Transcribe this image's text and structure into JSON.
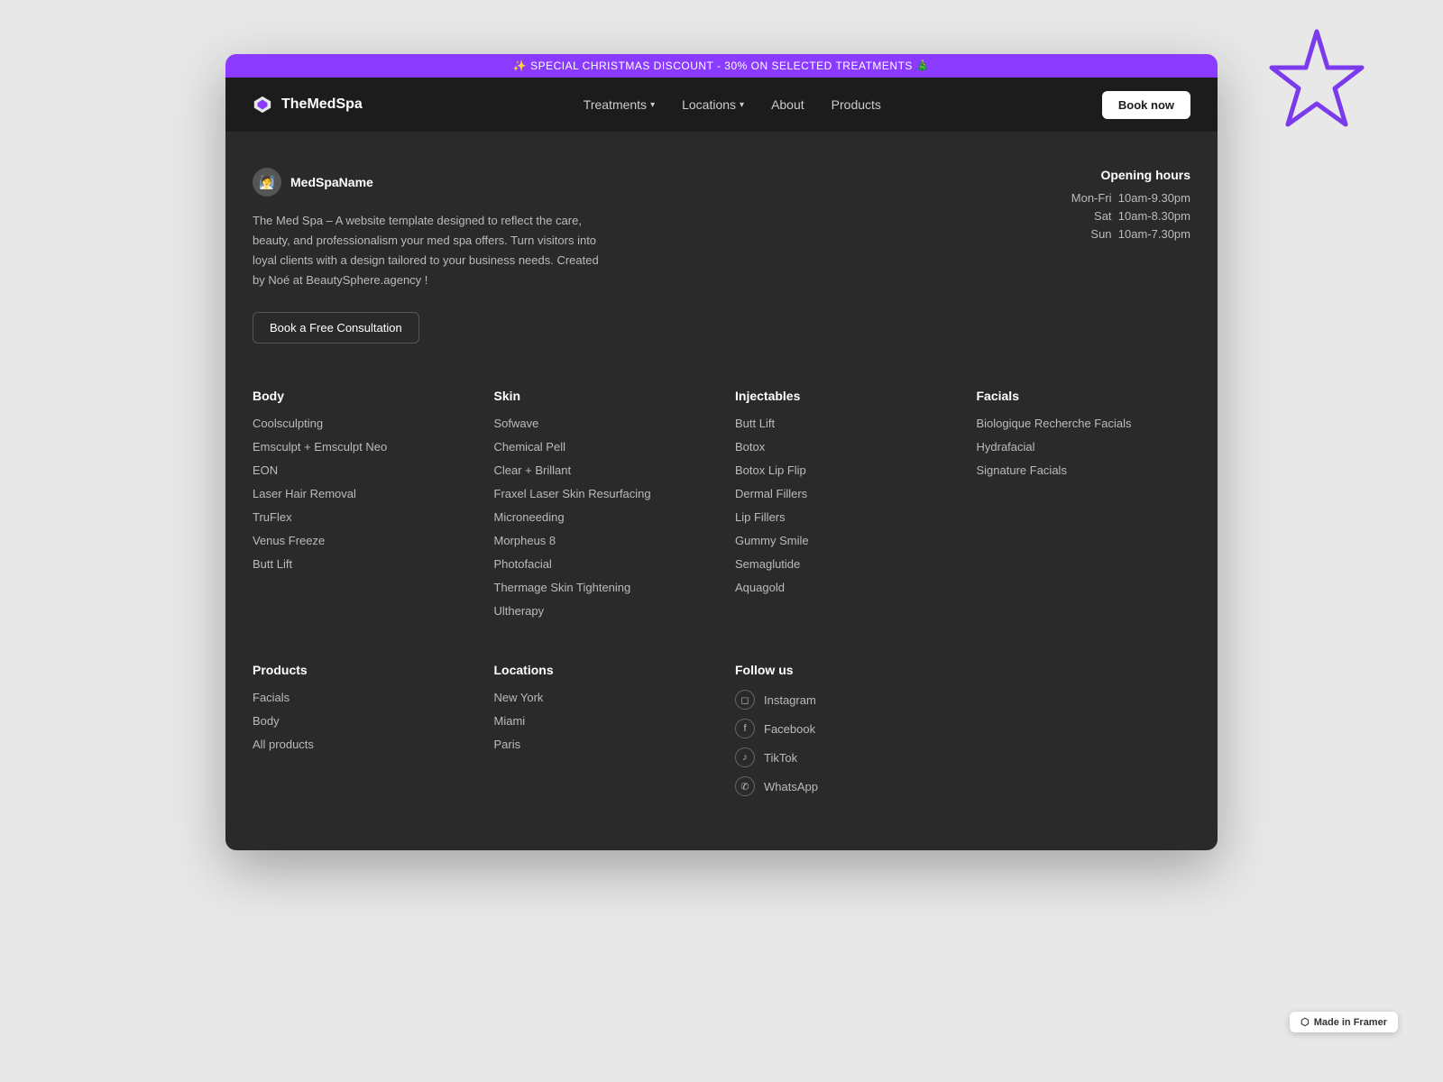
{
  "banner": {
    "text": "✨ SPECIAL CHRISTMAS DISCOUNT - 30% ON SELECTED TREATMENTS 🎄"
  },
  "navbar": {
    "logo_text": "TheMedSpa",
    "nav_items": [
      {
        "label": "Treatments",
        "has_dropdown": true
      },
      {
        "label": "Locations",
        "has_dropdown": true
      },
      {
        "label": "About",
        "has_dropdown": false
      },
      {
        "label": "Products",
        "has_dropdown": false
      }
    ],
    "book_btn": "Book now"
  },
  "hero": {
    "brand_name": "MedSpaName",
    "description": "The Med Spa – A website template designed to reflect the care, beauty, and professionalism your med spa offers. Turn visitors into loyal clients with a design tailored to your business needs. Created by Noé at BeautySphere.agency !",
    "consult_btn": "Book a Free Consultation",
    "opening_hours": {
      "title": "Opening hours",
      "rows": [
        {
          "day": "Mon-Fri",
          "hours": "10am-9.30pm"
        },
        {
          "day": "Sat",
          "hours": "10am-8.30pm"
        },
        {
          "day": "Sun",
          "hours": "10am-7.30pm"
        }
      ]
    }
  },
  "footer": {
    "body_col": {
      "title": "Body",
      "items": [
        "Coolsculpting",
        "Emsculpt + Emsculpt Neo",
        "EON",
        "Laser Hair Removal",
        "TruFlex",
        "Venus Freeze",
        "Butt Lift"
      ]
    },
    "skin_col": {
      "title": "Skin",
      "items": [
        "Sofwave",
        "Chemical Pell",
        "Clear + Brillant",
        "Fraxel Laser Skin Resurfacing",
        "Microneeding",
        "Morpheus 8",
        "Photofacial",
        "Thermage Skin Tightening",
        "Ultherapy"
      ]
    },
    "injectables_col": {
      "title": "Injectables",
      "items": [
        "Butt Lift",
        "Botox",
        "Botox Lip Flip",
        "Dermal Fillers",
        "Lip Fillers",
        "Gummy Smile",
        "Semaglutide",
        "Aquagold"
      ]
    },
    "facials_col": {
      "title": "Facials",
      "items": [
        "Biologique Recherche Facials",
        "Hydrafacial",
        "Signature Facials"
      ]
    },
    "products_col": {
      "title": "Products",
      "items": [
        "Facials",
        "Body",
        "All products"
      ]
    },
    "locations_col": {
      "title": "Locations",
      "items": [
        "New York",
        "Miami",
        "Paris"
      ]
    },
    "follow_col": {
      "title": "Follow us",
      "items": [
        {
          "label": "Instagram",
          "icon": "IG"
        },
        {
          "label": "Facebook",
          "icon": "f"
        },
        {
          "label": "TikTok",
          "icon": "TT"
        },
        {
          "label": "WhatsApp",
          "icon": "W"
        }
      ]
    }
  },
  "framer_badge": "Made in Framer"
}
